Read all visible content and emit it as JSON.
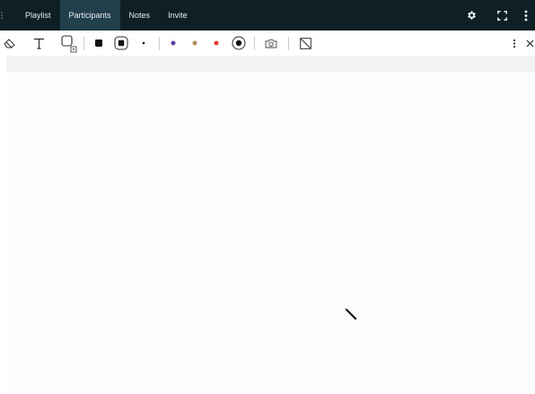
{
  "topbar": {
    "tabs": [
      {
        "label": "Playlist",
        "active": false
      },
      {
        "label": "Participants",
        "active": true
      },
      {
        "label": "Notes",
        "active": false
      },
      {
        "label": "Invite",
        "active": false
      }
    ],
    "right_icons": [
      "gear-icon",
      "fullscreen-icon",
      "more-vertical-icon"
    ]
  },
  "toolbar": {
    "tools": [
      "eraser-icon",
      "text-icon",
      "shape-icon",
      "fill-square-icon",
      "outline-square-icon",
      "dot-size-icon",
      "color-purple",
      "color-tan",
      "color-red",
      "color-black-selected",
      "camera-icon",
      "clear-canvas-icon",
      "more-vertical-icon",
      "close-icon"
    ],
    "colors": {
      "purple": "#5b3fa6",
      "tan": "#b08d57",
      "red": "#e53935",
      "black": "#111111"
    }
  },
  "theme": {
    "topbar_bg": "#0f1f26",
    "active_tab_bg": "#22404b"
  }
}
